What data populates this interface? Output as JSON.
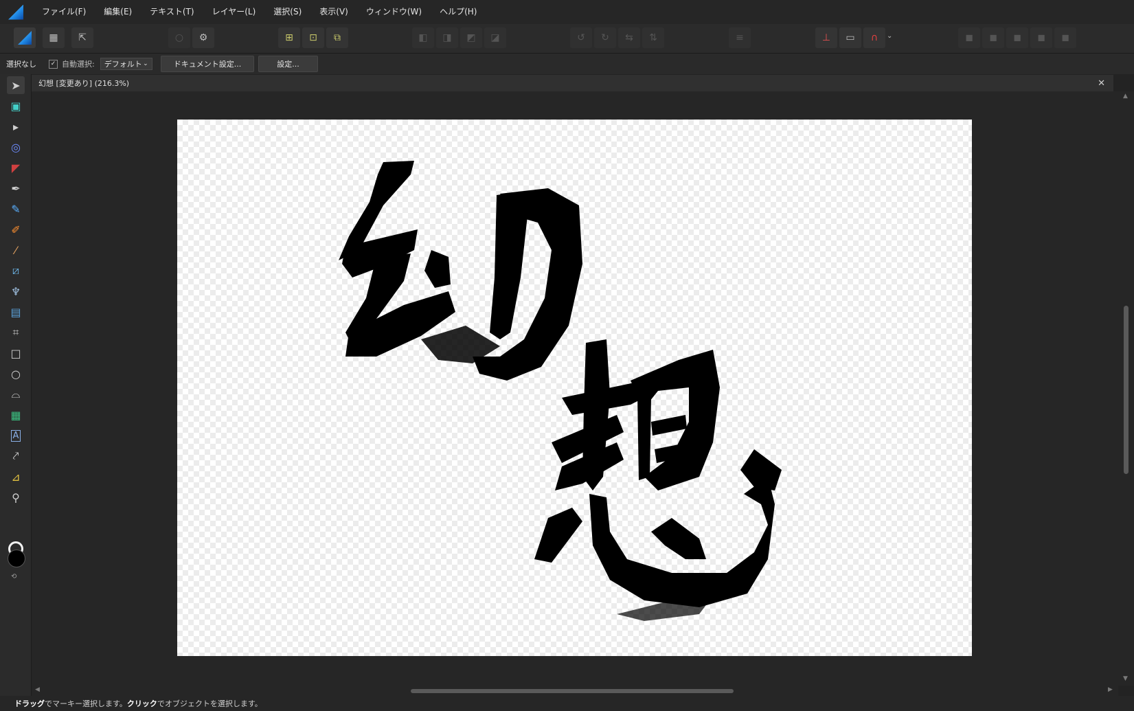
{
  "menubar": {
    "items": [
      "ファイル(F)",
      "編集(E)",
      "テキスト(T)",
      "レイヤー(L)",
      "選択(S)",
      "表示(V)",
      "ウィンドウ(W)",
      "ヘルプ(H)"
    ]
  },
  "toolbar": {
    "persona_icon": "designer-persona-icon",
    "accent": "#1e88e5"
  },
  "context": {
    "selection_label": "選択なし",
    "auto_select_checked": true,
    "auto_select_label": "自動選択:",
    "auto_select_value": "デフォルト",
    "document_setup_label": "ドキュメント設定...",
    "settings_label": "設定..."
  },
  "document": {
    "tab_title": "幻想 [変更あり] (216.3%)",
    "close_glyph": "✕",
    "artwork_text": "幻想"
  },
  "colors": {
    "fill": "#000000",
    "stroke": "#ffffff"
  },
  "status": {
    "drag": "ドラッグ",
    "text1": "でマーキー選択します。",
    "click": "クリック",
    "text2": "でオブジェクトを選択します。"
  }
}
